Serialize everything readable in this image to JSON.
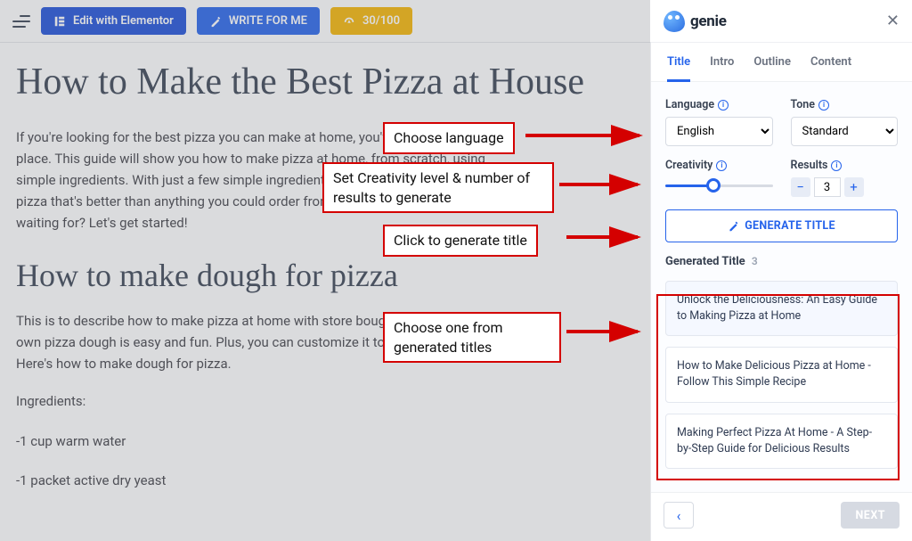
{
  "toolbar": {
    "elementor_label": "Edit with Elementor",
    "write_label": "WRITE FOR ME",
    "score_label": "30/100"
  },
  "editor": {
    "h1": "How to Make the Best Pizza at House",
    "p1": "If you're looking for the best pizza you can make at home, you've come to the right place. This guide will show you how to make pizza at home, from scratch, using simple ingredients. With just a few simple ingredients, you can have a delicious pizza that's better than anything you could order from a restaurant. So what are you waiting for? Let's get started!",
    "h2": "How to make dough for pizza",
    "p2": "This is to describe how to make pizza at home with store bought dough Making your own pizza dough is easy and fun. Plus, you can customize it to your own taste. Here's how to make dough for pizza.",
    "p3": "Ingredients:",
    "p4": "-1 cup warm water",
    "p5": "-1 packet active dry yeast"
  },
  "panel": {
    "brand": "genie",
    "tabs": {
      "title": "Title",
      "intro": "Intro",
      "outline": "Outline",
      "content": "Content"
    },
    "language": {
      "label": "Language",
      "value": "English"
    },
    "tone": {
      "label": "Tone",
      "value": "Standard"
    },
    "creativity": {
      "label": "Creativity"
    },
    "results": {
      "label": "Results",
      "value": "3"
    },
    "generate_btn": "GENERATE TITLE",
    "generated_title_h": "Generated Title",
    "generated_count": "3",
    "results_list": [
      "Unlock the Deliciousness: An Easy Guide to Making Pizza at Home",
      "How to Make Delicious Pizza at Home - Follow This Simple Recipe",
      "Making Perfect Pizza At Home - A Step-by-Step Guide for Delicious Results"
    ],
    "next": "NEXT"
  },
  "callouts": {
    "c1": "Choose language",
    "c2": "Set Creativity level & number of results to generate",
    "c3": "Click to generate title",
    "c4": "Choose one from generated titles"
  }
}
